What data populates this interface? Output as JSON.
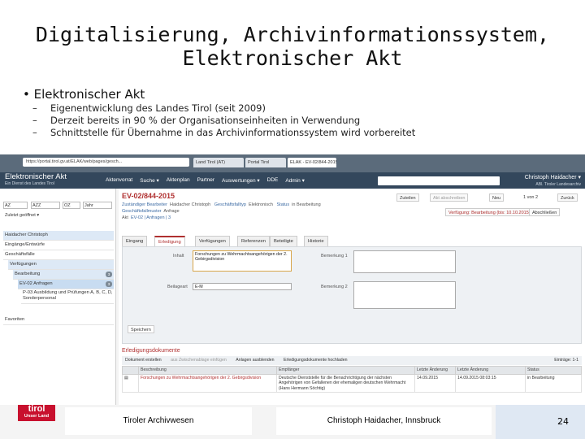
{
  "slide": {
    "title_line1": "Digitalisierung, Archivinformationssystem,",
    "title_line2": "Elektronischer Akt",
    "bullet": "Elektronischer Akt",
    "dash": "–",
    "sub_items": [
      "Eigenentwicklung des Landes Tirol (seit 2009)",
      "Derzeit bereits in 90 % der Organisationseinheiten in Verwendung",
      "Schnittstelle für Übernahme in das Archivinformationssystem wird vorbereitet"
    ]
  },
  "browser": {
    "url": "https://portal.tirol.gv.at/ELAK/web/pages/gesch...",
    "tabs": [
      "Land Tirol (AT)",
      "Portal Tirol",
      "ELAK - EV-02/844-2015 - Ab..."
    ]
  },
  "app": {
    "logo_title": "Elektronischer Akt",
    "logo_sub": "Ein Dienst des Landes Tirol",
    "menu": [
      "Aktenvorrat",
      "Suche ▾",
      "Aktenplan",
      "Partner",
      "Auswertungen ▾",
      "DDE",
      "Admin ▾"
    ],
    "user_name": "Christoph Haidacher ▾",
    "user_sub": "ABl. Tiroler Landesarchiv"
  },
  "left": {
    "inputs": [
      "AZ",
      "AZZ",
      "OZ",
      "Jahr"
    ],
    "sort": "Zuletzt geöffnet ▾",
    "nav": [
      {
        "label": "Haidacher Christoph",
        "count": ""
      },
      {
        "label": "Eingänge/Entwürfe",
        "count": ""
      },
      {
        "label": "Geschäftsfälle",
        "count": ""
      },
      {
        "label": "Verfügungen",
        "count": ""
      },
      {
        "label": "Bearbeitung",
        "count": "3"
      },
      {
        "label": "EV-02 Anfragen",
        "count": "3"
      },
      {
        "label": "P-03 Ausbildung und Prüfungen A, B, C, D, Sonderpersonal",
        "count": ""
      },
      {
        "label": "Favoriten",
        "count": ""
      }
    ]
  },
  "record": {
    "number": "EV-02/844-2015",
    "bearbeiter_label": "Zuständiger Bearbeiter",
    "bearbeiter": "Haidacher Christoph",
    "typ_label": "Geschäftsfalltyp",
    "typ": "Elektronisch",
    "status_label": "Status",
    "status": "in Bearbeitung",
    "muster_label": "Geschäftsfallmuster",
    "muster": "Anfrage",
    "akt_label": "Akt",
    "akt": "EV-02 | Anfragen | 3"
  },
  "toolbar": {
    "zuteilen": "Zuteilen",
    "abschreiben": "Akt abschreiben",
    "neu": "Neu",
    "page": "1 von 2",
    "zurueck": "Zurück",
    "verfuegung": "Verfügung: Bearbeitung (bis: 10.10.2015)",
    "abschliessen": "Abschließen"
  },
  "tabs": [
    "Eingang",
    "Erledigung",
    "Verfügungen",
    "Referenzen",
    "Beteiligte",
    "Historie"
  ],
  "form": {
    "inhalt_label": "Inhalt",
    "inhalt": "Forschungen zu Wehrmachtsangehörigen der 2. Gebirgsdivision",
    "beilage_label": "Beilageart",
    "beilage": "E-M",
    "bem1_label": "Bemerkung 1",
    "bem2_label": "Bemerkung 2",
    "save": "Speichern"
  },
  "docs": {
    "title": "Erledigungsdokumente",
    "toolbar": [
      "Dokument erstellen",
      "aus Zwischenablage einfügen",
      "Anlagen ausblenden",
      "Erledigungsdokumente hochladen"
    ],
    "count": "Einträge: 1-1",
    "headers": [
      "Beschreibung",
      "Empfänger",
      "Letzte Änderung",
      "Status"
    ],
    "headers_extra": "Letzte Änderung",
    "row": {
      "beschreibung": "Forschungen zu Wehrmachtsangehörigen der 2. Gebirgsdivision",
      "empfaenger": "Deutsche Dienststelle für die Benachrichtigung der nächsten Angehörigen von Gefallenen der ehemaligen deutschen Wehrmacht (Hans Hermann Söchtig)",
      "datum1": "14.09.2015",
      "datum2": "14.09.2015 08:03:15",
      "status": "in Bearbeitung"
    }
  },
  "footer": {
    "logo_top": "tirol",
    "logo_bottom": "Unser Land",
    "center": "Tiroler Archivwesen",
    "right": "Christoph Haidacher, Innsbruck",
    "page": "24"
  }
}
